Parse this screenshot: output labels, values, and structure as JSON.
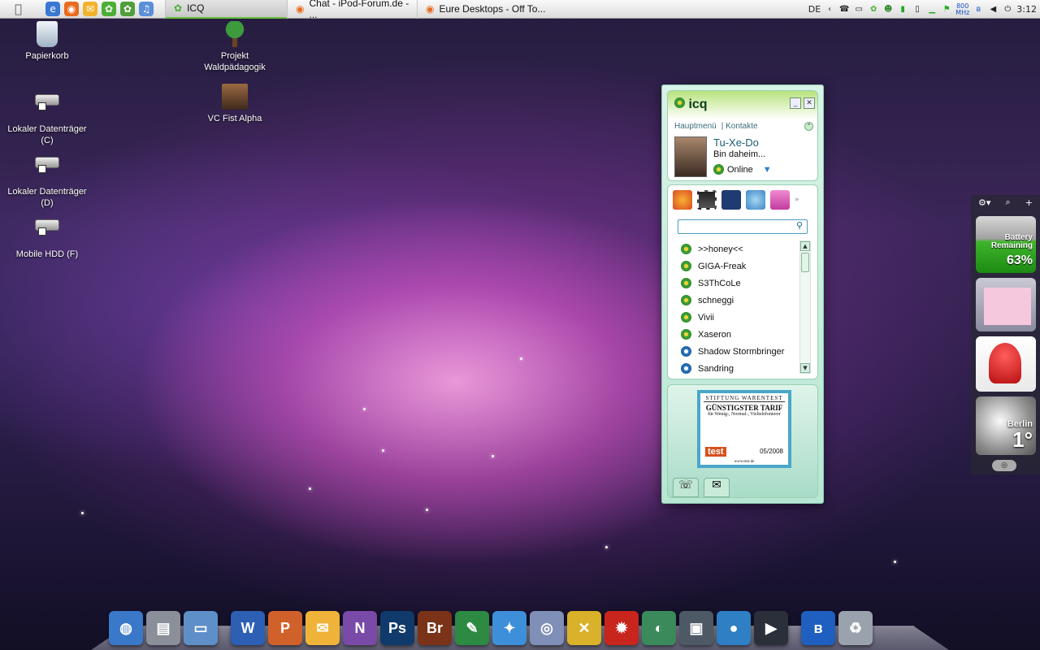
{
  "menubar": {
    "quicklaunch": [
      {
        "name": "ie",
        "color": "#3b78d4",
        "glyph": "e"
      },
      {
        "name": "firefox",
        "color": "#e86b1f",
        "glyph": "◉"
      },
      {
        "name": "mail",
        "color": "#f1b22c",
        "glyph": "✉"
      },
      {
        "name": "icq",
        "color": "#4caf37",
        "glyph": "✿"
      },
      {
        "name": "contacts",
        "color": "#4f9e3b",
        "glyph": "✿"
      },
      {
        "name": "itunes",
        "color": "#5b8fd8",
        "glyph": "♫"
      }
    ],
    "tasks": [
      {
        "label": "ICQ",
        "active": true,
        "icon_color": "#4caf37",
        "icon_glyph": "✿"
      },
      {
        "label": "Chat - iPod-Forum.de - ...",
        "active": false,
        "icon_color": "#e86b1f",
        "icon_glyph": "◉"
      },
      {
        "label": "Eure Desktops - Off To...",
        "active": false,
        "icon_color": "#e86b1f",
        "icon_glyph": "◉"
      }
    ],
    "tray": {
      "lang": "DE",
      "cpu_freq": "800",
      "cpu_unit": "MHz",
      "clock": "3:12"
    }
  },
  "desktop_icons": [
    {
      "label": "Papierkorb",
      "icon": "recycle-bin-icon"
    },
    {
      "label": "Lokaler Datenträger (C)",
      "icon": "drive-icon"
    },
    {
      "label": "Lokaler Datenträger (D)",
      "icon": "drive-icon"
    },
    {
      "label": "Mobile HDD (F)",
      "icon": "drive-icon"
    },
    {
      "label": "Projekt Waldpädagogik",
      "icon": "tree-icon"
    },
    {
      "label": "VC Fist Alpha",
      "icon": "game-icon"
    }
  ],
  "icq": {
    "logo": "icq",
    "menu_main": "Hauptmenü",
    "menu_contacts": "Kontakte",
    "nick": "Tu-Xe-Do",
    "status_message": "Bin daheim...",
    "status": "Online",
    "search_placeholder": "",
    "contacts": [
      {
        "name": ">>honey<<",
        "state": "online"
      },
      {
        "name": "GIGA-Freak",
        "state": "online"
      },
      {
        "name": "S3ThCoLe",
        "state": "online"
      },
      {
        "name": "schneggi",
        "state": "online"
      },
      {
        "name": "Vivii",
        "state": "online"
      },
      {
        "name": "Xaseron",
        "state": "online"
      },
      {
        "name": "Shadow Stormbringer",
        "state": "away"
      },
      {
        "name": "Sandring",
        "state": "na"
      }
    ],
    "ad": {
      "line1": "STIFTUNG WARENTEST",
      "line2": "GÜNSTIGSTER TARIF",
      "line3": "für Wenig-, Normal-, Vieltelefonierer",
      "brand": "test",
      "date": "05/2008",
      "url": "www.test.de"
    }
  },
  "gadgets": {
    "battery_label1": "Battery",
    "battery_label2": "Remaining",
    "battery_value": "63%",
    "city": "Berlin",
    "temperature": "1°"
  },
  "dock": [
    {
      "name": "network",
      "color": "#3a78c9",
      "glyph": "◍"
    },
    {
      "name": "computer",
      "color": "#8a8f99",
      "glyph": "▤"
    },
    {
      "name": "documents",
      "color": "#5f8fc9",
      "glyph": "▭"
    },
    {
      "name": "word",
      "color": "#2d5fb4",
      "glyph": "W"
    },
    {
      "name": "powerpoint",
      "color": "#d1612a",
      "glyph": "P"
    },
    {
      "name": "outlook",
      "color": "#f0b33a",
      "glyph": "✉"
    },
    {
      "name": "onenote",
      "color": "#7a4aa8",
      "glyph": "N"
    },
    {
      "name": "photoshop",
      "color": "#0f3a6b",
      "glyph": "Ps"
    },
    {
      "name": "bridge",
      "color": "#7a3318",
      "glyph": "Br"
    },
    {
      "name": "photo-viewer",
      "color": "#2d8a43",
      "glyph": "✎"
    },
    {
      "name": "safari",
      "color": "#3d8fd9",
      "glyph": "✦"
    },
    {
      "name": "dvd",
      "color": "#7f8fb8",
      "glyph": "◎"
    },
    {
      "name": "utilities",
      "color": "#d9b12a",
      "glyph": "✕"
    },
    {
      "name": "burner",
      "color": "#c8251d",
      "glyph": "✹"
    },
    {
      "name": "globe",
      "color": "#3a8a5c",
      "glyph": "◐"
    },
    {
      "name": "camera",
      "color": "#4d5a66",
      "glyph": "▣"
    },
    {
      "name": "media",
      "color": "#2e7fc4",
      "glyph": "●"
    },
    {
      "name": "movie",
      "color": "#2b2f3a",
      "glyph": "▶"
    },
    {
      "name": "bluetooth",
      "color": "#1f5fbf",
      "glyph": "ʙ"
    },
    {
      "name": "trash",
      "color": "#9aa3ad",
      "glyph": "♻"
    }
  ]
}
